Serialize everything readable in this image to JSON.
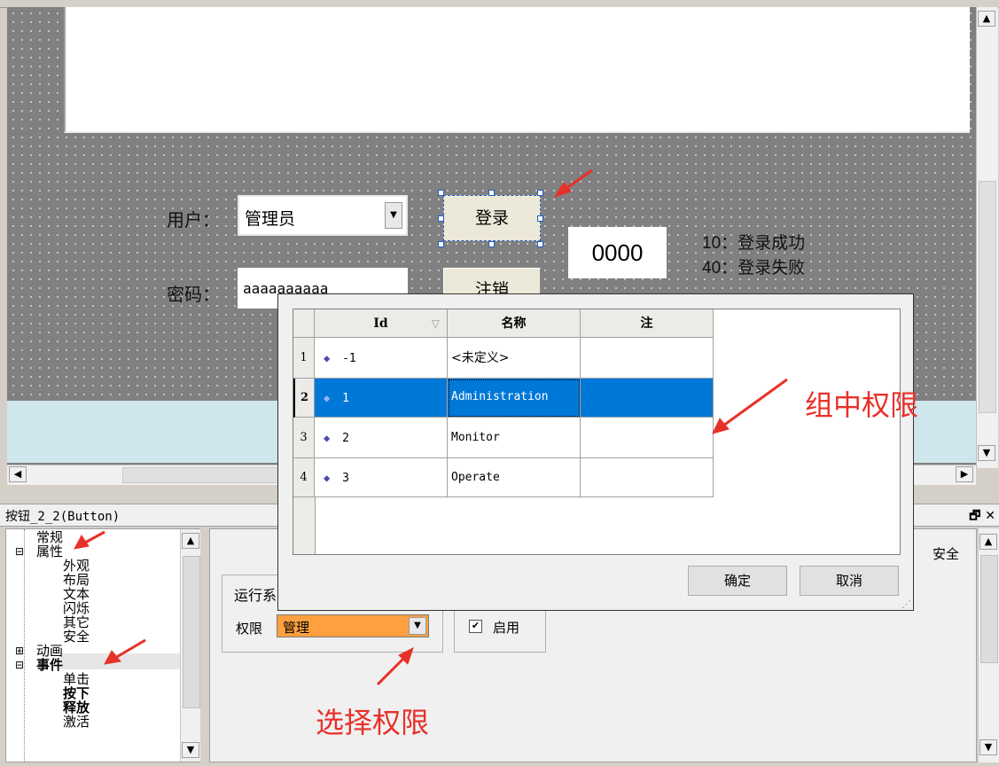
{
  "designer": {
    "user_label": "用户：",
    "user_value": "管理员",
    "password_label": "密码：",
    "password_value": "aaaaaaaaaa",
    "login_button": "登录",
    "logout_button": "注销",
    "status_code": "0000",
    "legend_line1": "10：登录成功",
    "legend_line2": "40：登录失败"
  },
  "panel": {
    "title": "按钮_2_2(Button)",
    "window_controls": "🗗 ✕"
  },
  "tree": {
    "items": [
      "常规",
      "属性",
      "外观",
      "布局",
      "文本",
      "闪烁",
      "其它",
      "安全",
      "动画",
      "事件",
      "单击",
      "按下",
      "释放",
      "激活"
    ],
    "expander_minus": "⊟",
    "expander_plus": "⊞"
  },
  "properties": {
    "group_title": "运行系",
    "permission_label": "权限",
    "permission_value": "管理",
    "enable_label": "启用",
    "security_tab": "安全"
  },
  "dialog": {
    "columns": [
      "Id",
      "名称",
      "注"
    ],
    "rows": [
      {
        "num": "1",
        "id": "-1",
        "name": "<未定义>",
        "note": ""
      },
      {
        "num": "2",
        "id": "1",
        "name": "Administration",
        "note": ""
      },
      {
        "num": "3",
        "id": "2",
        "name": "Monitor",
        "note": ""
      },
      {
        "num": "4",
        "id": "3",
        "name": "Operate",
        "note": ""
      }
    ],
    "selected_row": 2,
    "ok_button": "确定",
    "cancel_button": "取消"
  },
  "annotations": {
    "group_permission": "组中权限",
    "select_permission": "选择权限"
  },
  "colors": {
    "selection": "#0078d7",
    "permission_combo": "#ffa040",
    "annotation": "#e8302a"
  }
}
